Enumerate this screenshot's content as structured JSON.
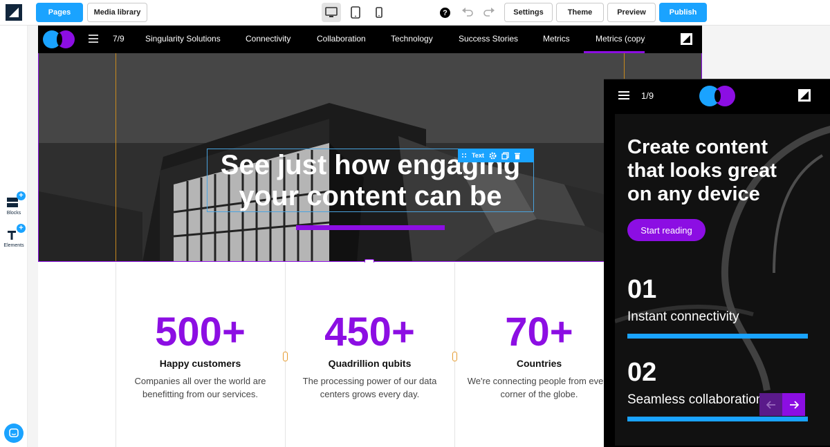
{
  "toolbar": {
    "pages_label": "Pages",
    "media_label": "Media library",
    "settings_label": "Settings",
    "theme_label": "Theme",
    "preview_label": "Preview",
    "publish_label": "Publish",
    "help_glyph": "?",
    "active_device": "desktop",
    "accent": "#1aa3ff"
  },
  "rail": {
    "blocks_label": "Blocks",
    "elements_label": "Elements"
  },
  "site": {
    "nav_count": "7/9",
    "nav_items": [
      "Singularity Solutions",
      "Connectivity",
      "Collaboration",
      "Technology",
      "Success Stories",
      "Metrics",
      "Metrics (copy)"
    ],
    "active_nav": "Metrics (copy)",
    "brand_colors": [
      "#1aa3ff",
      "#8c0ee3"
    ]
  },
  "hero": {
    "title_line1": "See just how engaging",
    "title_line2": "your content can be",
    "toolbar_label": "Text"
  },
  "stats": [
    {
      "number": "500+",
      "title": "Happy customers",
      "desc_line1": "Companies all over the world are",
      "desc_line2": "benefitting from our services."
    },
    {
      "number": "450+",
      "title": "Quadrillion qubits",
      "desc_line1": "The processing power of our data",
      "desc_line2": "centers grows every day."
    },
    {
      "number": "70+",
      "title": "Countries",
      "desc_line1": "We're connecting people from every",
      "desc_line2": "corner of the globe."
    }
  ],
  "mobile": {
    "count": "1/9",
    "title_line1": "Create content",
    "title_line2": "that looks great",
    "title_line3": "on any device",
    "cta": "Start reading",
    "items": [
      {
        "number": "01",
        "label": "Instant connectivity"
      },
      {
        "number": "02",
        "label": "Seamless collaboration"
      }
    ]
  }
}
